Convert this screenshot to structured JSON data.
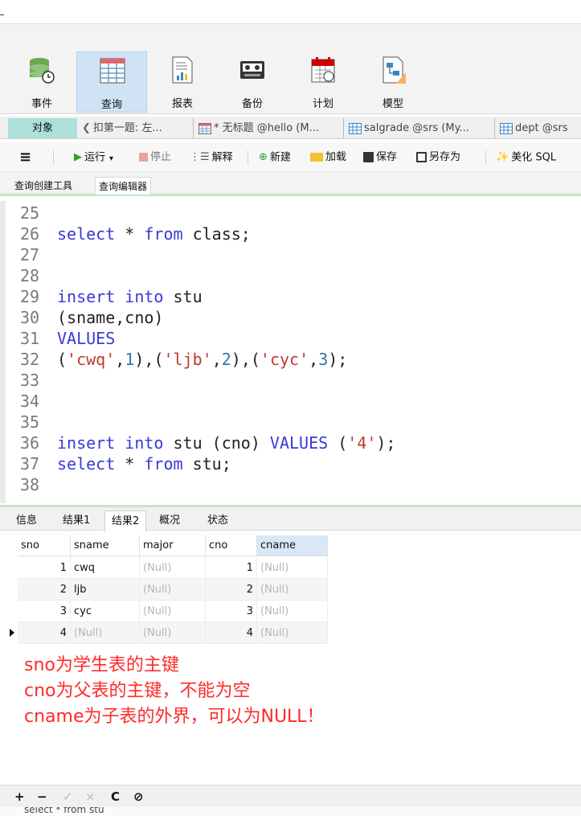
{
  "ribbon": {
    "buttons": [
      {
        "label": "事件",
        "icon": "event-icon"
      },
      {
        "label": "查询",
        "icon": "query-icon",
        "active": true
      },
      {
        "label": "报表",
        "icon": "report-icon"
      },
      {
        "label": "备份",
        "icon": "backup-icon"
      },
      {
        "label": "计划",
        "icon": "schedule-icon"
      },
      {
        "label": "模型",
        "icon": "model-icon"
      }
    ]
  },
  "tabs": {
    "objects_label": "对象",
    "doc_tabs": [
      {
        "label": "扣第一题: 左...",
        "icon": "query-tab-icon"
      },
      {
        "label": "* 无标题 @hello (M...",
        "icon": "query-tab-icon"
      },
      {
        "label": "salgrade @srs (My...",
        "icon": "table-icon"
      },
      {
        "label": "dept @srs",
        "icon": "table-icon"
      }
    ]
  },
  "toolbar": {
    "menu_icon": "menu-icon",
    "run_label": "运行",
    "stop_label": "停止",
    "explain_label": "解释",
    "new_label": "新建",
    "load_label": "加载",
    "save_label": "保存",
    "saveas_label": "另存为",
    "beautify_label": "美化 SQL"
  },
  "subtabs": {
    "builder_label": "查询创建工具",
    "editor_label": "查询编辑器"
  },
  "editor": {
    "lines": [
      {
        "n": "25",
        "text": ""
      },
      {
        "n": "26",
        "text": "select * from class;"
      },
      {
        "n": "27",
        "text": ""
      },
      {
        "n": "28",
        "text": ""
      },
      {
        "n": "29",
        "text": "insert into stu"
      },
      {
        "n": "30",
        "text": "(sname,cno)"
      },
      {
        "n": "31",
        "text": "VALUES"
      },
      {
        "n": "32",
        "text": "('cwq',1),('ljb',2),('cyc',3);"
      },
      {
        "n": "33",
        "text": ""
      },
      {
        "n": "34",
        "text": ""
      },
      {
        "n": "35",
        "text": ""
      },
      {
        "n": "36",
        "text": "insert into stu (cno) VALUES ('4');"
      },
      {
        "n": "37",
        "text": "select * from stu;"
      },
      {
        "n": "38",
        "text": ""
      }
    ]
  },
  "results": {
    "tabs": [
      "信息",
      "结果1",
      "结果2",
      "概况",
      "状态"
    ],
    "active_tab": "结果2",
    "columns": [
      "sno",
      "sname",
      "major",
      "cno",
      "cname"
    ],
    "rows": [
      {
        "sno": "1",
        "sname": "cwq",
        "major": "(Null)",
        "cno": "1",
        "cname": "(Null)"
      },
      {
        "sno": "2",
        "sname": "ljb",
        "major": "(Null)",
        "cno": "2",
        "cname": "(Null)"
      },
      {
        "sno": "3",
        "sname": "cyc",
        "major": "(Null)",
        "cno": "3",
        "cname": "(Null)"
      },
      {
        "sno": "4",
        "sname": "(Null)",
        "major": "(Null)",
        "cno": "4",
        "cname": "(Null)"
      }
    ]
  },
  "annotation": {
    "lines": [
      "sno为学生表的主键",
      "cno为父表的主键，不能为空",
      "cname为子表的外界，可以为NULL！"
    ],
    "color": "#ff2a2a"
  },
  "bottom_nav": {
    "add": "+",
    "remove": "−",
    "apply": "✓",
    "discard": "×",
    "refresh": "C",
    "stop": "⊘"
  },
  "status": {
    "text": "select * from stu"
  }
}
